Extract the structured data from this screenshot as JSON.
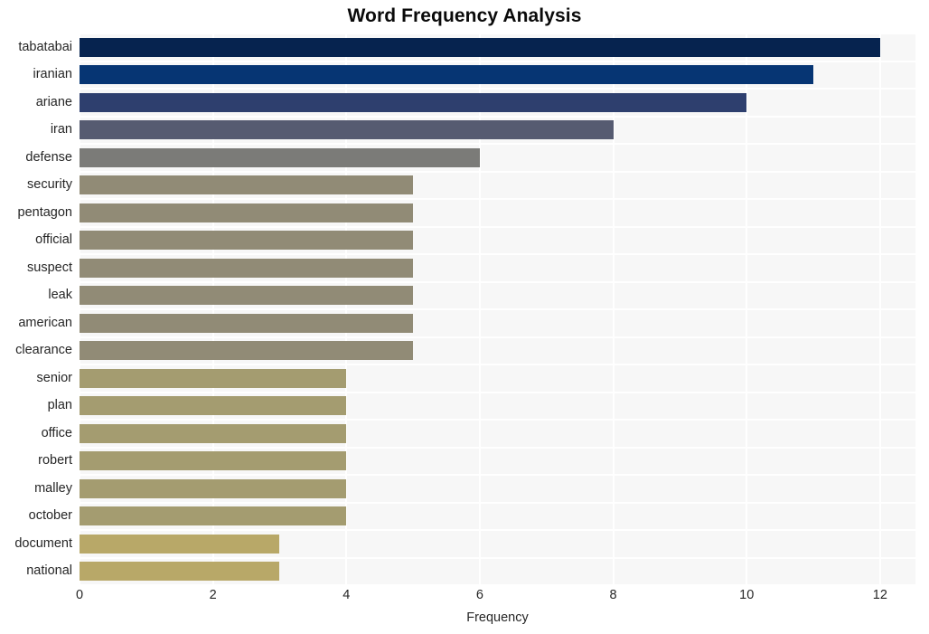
{
  "chart_data": {
    "type": "bar",
    "orientation": "horizontal",
    "title": "Word Frequency Analysis",
    "xlabel": "Frequency",
    "ylabel": "",
    "xlim": [
      0,
      12.53
    ],
    "xticks": [
      0,
      2,
      4,
      6,
      8,
      10,
      12
    ],
    "xticklabels": [
      "0",
      "2",
      "4",
      "6",
      "8",
      "10",
      "12"
    ],
    "grid": true,
    "legend": false,
    "categories": [
      "tabatabai",
      "iranian",
      "ariane",
      "iran",
      "defense",
      "security",
      "pentagon",
      "official",
      "suspect",
      "leak",
      "american",
      "clearance",
      "senior",
      "plan",
      "office",
      "robert",
      "malley",
      "october",
      "document",
      "national"
    ],
    "values": [
      12,
      11,
      10,
      8,
      6,
      5,
      5,
      5,
      5,
      5,
      5,
      5,
      4,
      4,
      4,
      4,
      4,
      4,
      3,
      3
    ],
    "bar_colors": [
      "#06234f",
      "#063573",
      "#2e3f6e",
      "#565b71",
      "#7b7b78",
      "#918b76",
      "#918b76",
      "#918b76",
      "#918b76",
      "#918b76",
      "#918b76",
      "#918b76",
      "#a49c70",
      "#a49c70",
      "#a49c70",
      "#a49c70",
      "#a49c70",
      "#a49c70",
      "#b8a868",
      "#b8a868"
    ],
    "plot_background": "#f7f7f7",
    "grid_color": "#ffffff",
    "figure_background": "#ffffff",
    "text_color": "#262626",
    "title_color": "#0a0a0a"
  }
}
